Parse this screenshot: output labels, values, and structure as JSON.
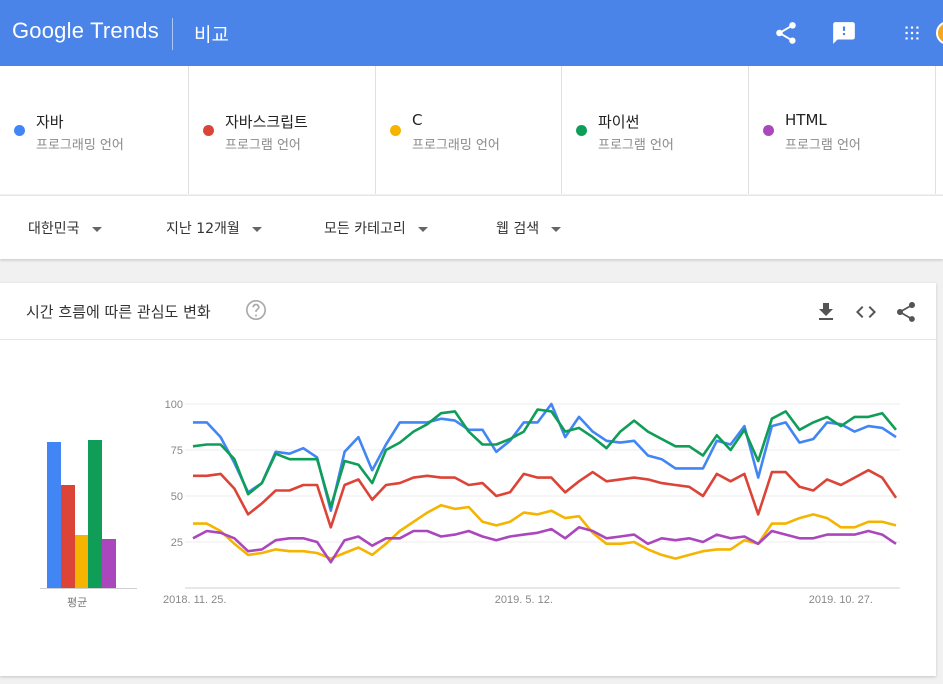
{
  "header": {
    "logo_google": "Google",
    "logo_trends": "Trends",
    "page_title": "비교",
    "icons": [
      "share-icon",
      "feedback-icon",
      "apps-icon",
      "avatar"
    ]
  },
  "terms": [
    {
      "name": "자바",
      "sub": "프로그래밍 언어",
      "color": "#4285f4"
    },
    {
      "name": "자바스크립트",
      "sub": "프로그램 언어",
      "color": "#db4437"
    },
    {
      "name": "C",
      "sub": "프로그래밍 언어",
      "color": "#f4b400"
    },
    {
      "name": "파이썬",
      "sub": "프로그램 언어",
      "color": "#0f9d58"
    },
    {
      "name": "HTML",
      "sub": "프로그램 언어",
      "color": "#ab47bc"
    }
  ],
  "filters": {
    "region": "대한민국",
    "period": "지난 12개월",
    "category": "모든 카테고리",
    "search_type": "웹 검색"
  },
  "card": {
    "title": "시간 흐름에 따른 관심도 변화",
    "avg_label": "평균"
  },
  "chart_data": {
    "type": "line",
    "ylim": [
      0,
      100
    ],
    "yticks": [
      25,
      50,
      75,
      100
    ],
    "xtick_labels": [
      "2018. 11. 25.",
      "2019. 5. 12.",
      "2019. 10. 27."
    ],
    "xtick_index": [
      0,
      24,
      47
    ],
    "averages": [
      {
        "name": "자바",
        "value": 79
      },
      {
        "name": "자바스크립트",
        "value": 56
      },
      {
        "name": "C",
        "value": 29
      },
      {
        "name": "파이썬",
        "value": 80
      },
      {
        "name": "HTML",
        "value": 27
      }
    ],
    "series": [
      {
        "name": "자바",
        "color": "#4285f4",
        "values": [
          90,
          90,
          82,
          68,
          52,
          57,
          74,
          73,
          76,
          71,
          42,
          74,
          82,
          64,
          78,
          90,
          90,
          90,
          92,
          91,
          86,
          86,
          74,
          80,
          90,
          90,
          100,
          82,
          93,
          85,
          80,
          79,
          80,
          72,
          70,
          65,
          65,
          65,
          80,
          78,
          88,
          60,
          88,
          90,
          79,
          81,
          90,
          89,
          85,
          88,
          87,
          82
        ]
      },
      {
        "name": "자바스크립트",
        "color": "#db4437",
        "values": [
          61,
          61,
          62,
          54,
          40,
          46,
          53,
          53,
          56,
          56,
          33,
          56,
          59,
          48,
          56,
          57,
          60,
          61,
          60,
          60,
          56,
          57,
          50,
          52,
          62,
          60,
          60,
          52,
          58,
          63,
          58,
          59,
          60,
          59,
          57,
          56,
          55,
          50,
          62,
          58,
          62,
          40,
          63,
          63,
          55,
          53,
          59,
          56,
          60,
          64,
          60,
          49
        ]
      },
      {
        "name": "C",
        "color": "#f4b400",
        "values": [
          35,
          35,
          31,
          24,
          18,
          19,
          21,
          20,
          20,
          19,
          16,
          19,
          22,
          18,
          24,
          31,
          36,
          41,
          45,
          43,
          44,
          36,
          34,
          36,
          41,
          40,
          42,
          38,
          39,
          30,
          24,
          24,
          25,
          21,
          18,
          16,
          18,
          20,
          21,
          21,
          26,
          24,
          35,
          35,
          38,
          40,
          38,
          33,
          33,
          36,
          36,
          34
        ]
      },
      {
        "name": "파이썬",
        "color": "#0f9d58",
        "values": [
          77,
          78,
          78,
          70,
          51,
          57,
          73,
          70,
          70,
          70,
          44,
          69,
          67,
          57,
          75,
          79,
          85,
          89,
          95,
          96,
          85,
          78,
          78,
          81,
          85,
          97,
          96,
          85,
          87,
          82,
          76,
          85,
          91,
          85,
          81,
          77,
          77,
          72,
          83,
          75,
          86,
          69,
          92,
          96,
          86,
          90,
          93,
          88,
          93,
          93,
          95,
          86
        ]
      },
      {
        "name": "HTML",
        "color": "#ab47bc",
        "values": [
          27,
          31,
          30,
          27,
          20,
          21,
          26,
          27,
          27,
          25,
          14,
          26,
          28,
          23,
          27,
          27,
          31,
          31,
          28,
          29,
          31,
          28,
          26,
          28,
          29,
          30,
          32,
          27,
          33,
          31,
          27,
          28,
          29,
          24,
          27,
          26,
          27,
          25,
          29,
          27,
          28,
          24,
          31,
          29,
          27,
          27,
          29,
          29,
          29,
          31,
          29,
          24
        ]
      }
    ]
  }
}
